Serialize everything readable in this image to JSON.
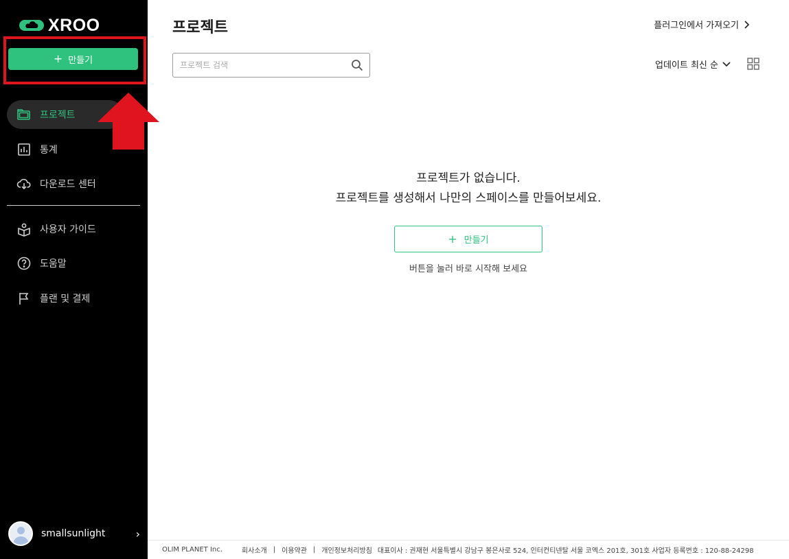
{
  "sidebar": {
    "logo_text": "XROO",
    "create_label": "만들기",
    "nav": [
      {
        "label": "프로젝트",
        "icon": "folder-icon",
        "active": true
      },
      {
        "label": "통계",
        "icon": "chart-icon"
      },
      {
        "label": "다운로드 센터",
        "icon": "cloud-download-icon"
      },
      {
        "label": "사용자 가이드",
        "icon": "guide-book-icon"
      },
      {
        "label": "도움말",
        "icon": "help-icon"
      },
      {
        "label": "플랜 및 결제",
        "icon": "flag-icon"
      }
    ],
    "user": {
      "name": "smallsunlight"
    }
  },
  "header": {
    "title": "프로젝트",
    "import_link": "플러그인에서 가져오기"
  },
  "toolbar": {
    "search_placeholder": "프로젝트 검색",
    "sort_label": "업데이트 최신 순"
  },
  "empty_state": {
    "title": "프로젝트가 없습니다.",
    "subtitle": "프로젝트를 생성해서 나만의 스페이스를 만들어보세요.",
    "create_label": "만들기",
    "hint": "버튼을 눌러 바로 시작해 보세요"
  },
  "footer": {
    "company": "OLIM PLANET Inc.",
    "links": [
      "회사소개",
      "이용약관",
      "개인정보처리방침"
    ],
    "info": "대표이사 : 권재현  서울특별시 강남구 봉은사로 524, 인터컨티넨탈 서울 코엑스 201호, 301호  사업자 등록번호 : 120-88-24298"
  },
  "colors": {
    "accent": "#2fc27e",
    "sidebar_bg": "#000000",
    "highlight_red": "#e0141e"
  }
}
